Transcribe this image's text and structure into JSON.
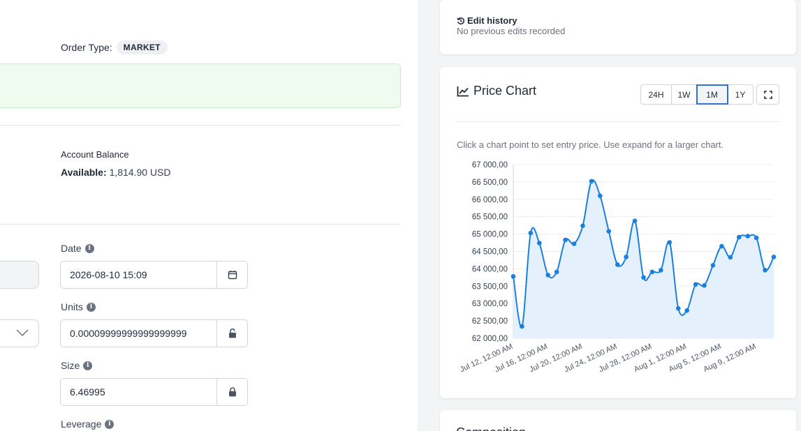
{
  "order": {
    "type_label": "Order Type:",
    "type_value": "MARKET"
  },
  "account": {
    "title": "Account Balance",
    "available_label": "Available:",
    "available_value": "1,814.90 USD"
  },
  "fields": {
    "date": {
      "label": "Date",
      "value": "2026-08-10 15:09",
      "addon_icon": "calendar-icon"
    },
    "units": {
      "label": "Units",
      "value": "0.00009999999999999999",
      "addon_icon": "lock-open-icon"
    },
    "size": {
      "label": "Size",
      "value": "6.46995",
      "addon_icon": "lock-icon"
    },
    "leverage": {
      "label": "Leverage"
    }
  },
  "edit_history": {
    "title": "Edit history",
    "subtitle": "No previous edits recorded",
    "icon": "history-icon"
  },
  "price_chart": {
    "title": "Price Chart",
    "icon": "chart-line-icon",
    "ranges": [
      "24H",
      "1W",
      "1M",
      "1Y"
    ],
    "active_range": "1M",
    "expand_icon": "expand-icon",
    "hint": "Click a chart point to set entry price. Use expand for a larger chart."
  },
  "bottom_card": {
    "title": "Composition"
  },
  "colors": {
    "accent": "#2f6fd8",
    "line": "#1b7fe0",
    "area": "#e4f1fc",
    "success_bg": "#effbef"
  },
  "chart_data": {
    "type": "area",
    "title": "",
    "xlabel": "",
    "ylabel": "",
    "ylim": [
      62000,
      67000
    ],
    "y_ticks": [
      "67 000,00",
      "66 500,00",
      "66 000,00",
      "65 500,00",
      "65 000,00",
      "64 500,00",
      "64 000,00",
      "63 500,00",
      "63 000,00",
      "62 500,00",
      "62 000,00"
    ],
    "x_ticks": [
      "Jul 12, 12:00 AM",
      "Jul 16, 12:00 AM",
      "Jul 20, 12:00 AM",
      "Jul 24, 12:00 AM",
      "Jul 28, 12:00 AM",
      "Aug 1, 12:00 AM",
      "Aug 5, 12:00 AM",
      "Aug 9, 12:00 AM"
    ],
    "grid": true,
    "series": [
      {
        "values": [
          63780,
          62340,
          65030,
          64740,
          63820,
          63910,
          64830,
          64720,
          65240,
          66520,
          66100,
          65080,
          64120,
          64340,
          65380,
          63750,
          63910,
          63960,
          64760,
          62860,
          62800,
          63550,
          63520,
          64100,
          64650,
          64330,
          64910,
          64940,
          64890,
          63960,
          64340
        ]
      }
    ]
  }
}
